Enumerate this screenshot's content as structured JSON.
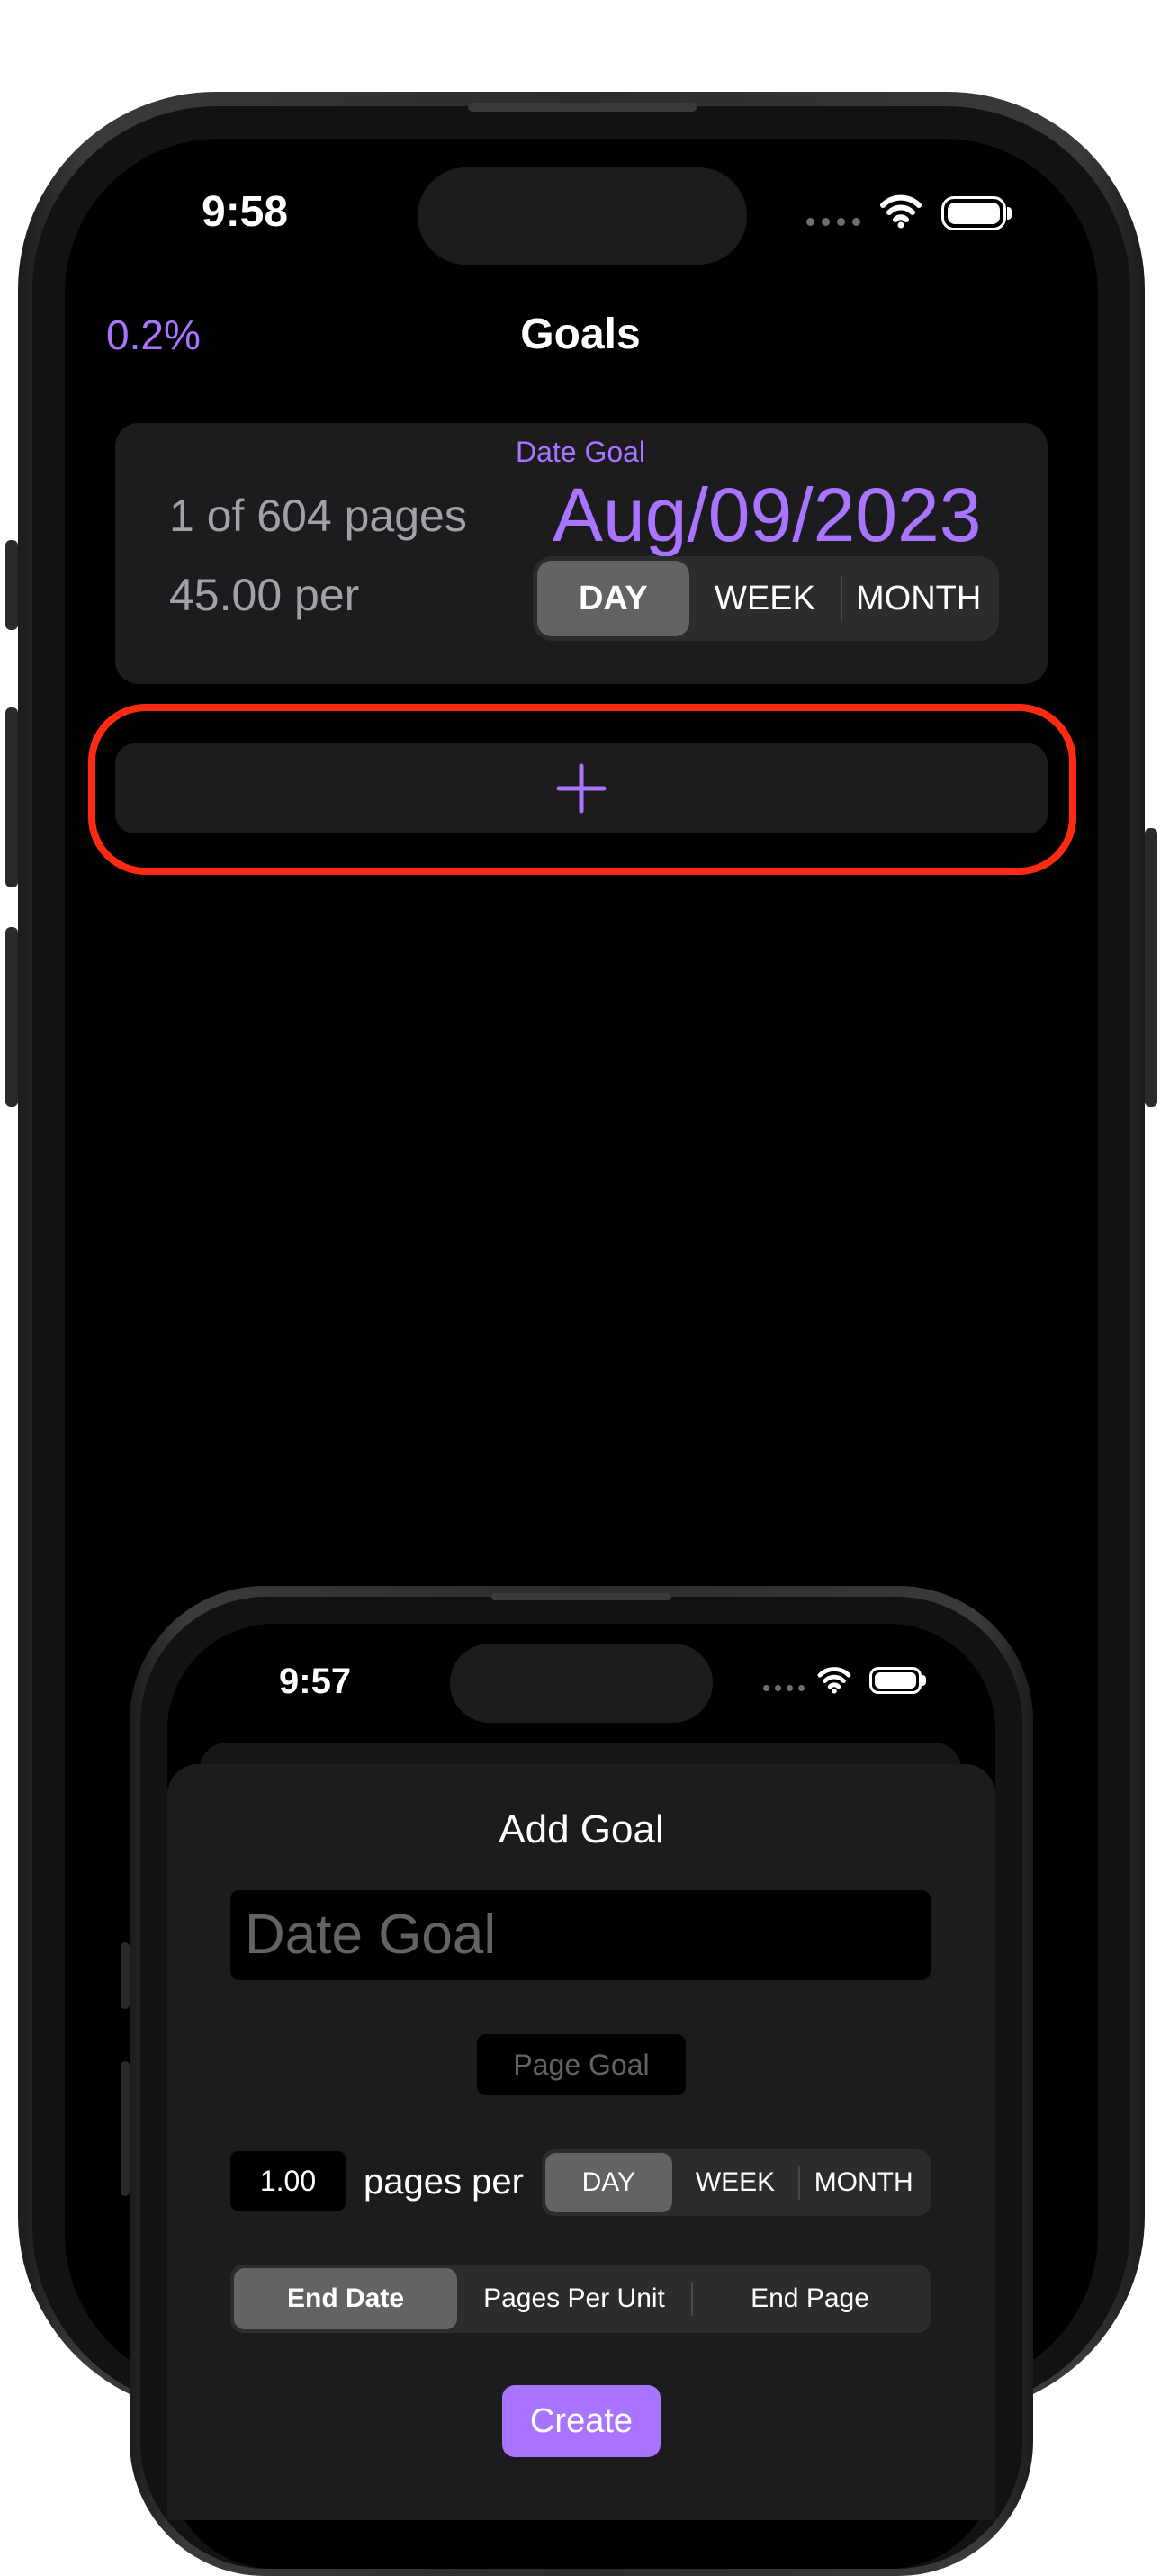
{
  "main_phone": {
    "status_bar": {
      "time": "9:58"
    },
    "nav": {
      "progress": "0.2%",
      "title": "Goals"
    },
    "goal_card": {
      "type_label": "Date Goal",
      "pages_text": "1 of 604 pages",
      "rate_text": "45.00 per",
      "date": "Aug/09/2023",
      "period_options": [
        "DAY",
        "WEEK",
        "MONTH"
      ],
      "selected_period": "DAY"
    },
    "add_button": {
      "symbol": "+"
    }
  },
  "sheet_phone": {
    "status_bar": {
      "time": "9:57"
    },
    "add_goal": {
      "title": "Add Goal",
      "goal_name_placeholder": "Date Goal",
      "type_toggle_label": "Page Goal",
      "pages_value": "1.00",
      "pages_per_label": "pages per",
      "period_options": [
        "DAY",
        "WEEK",
        "MONTH"
      ],
      "selected_period": "DAY",
      "mode_options": [
        "End Date",
        "Pages Per Unit",
        "End Page"
      ],
      "selected_mode": "End Date",
      "create_label": "Create"
    }
  },
  "colors": {
    "accent": "#a974ff",
    "highlight": "#ff2a12",
    "card_bg": "#1c1c1e",
    "screen_bg": "#000000"
  }
}
